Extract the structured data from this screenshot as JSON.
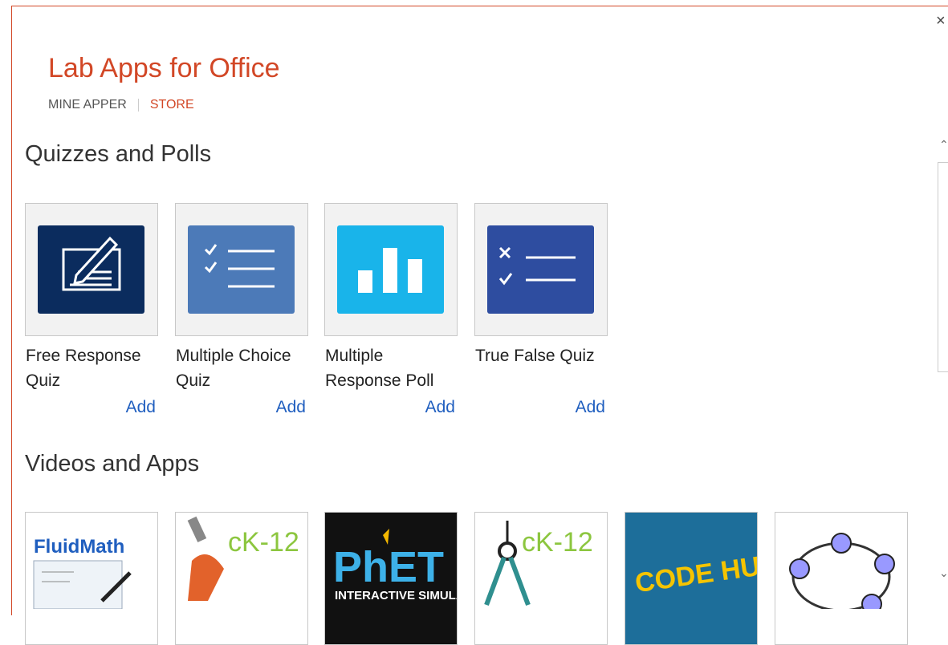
{
  "window": {
    "close_label": "×"
  },
  "header": {
    "title": "Lab Apps for Office",
    "tabs": [
      {
        "label": "MINE APPER"
      },
      {
        "label": "STORE"
      }
    ]
  },
  "sections": [
    {
      "title": "Quizzes and Polls",
      "items": [
        {
          "name": "Free Response Quiz",
          "add": "Add",
          "icon": "pencil-paper-icon",
          "color": "#0b2c5e"
        },
        {
          "name": "Multiple Choice Quiz",
          "add": "Add",
          "icon": "checklist-icon",
          "color": "#4c7ab8"
        },
        {
          "name": "Multiple Response Poll",
          "add": "Add",
          "icon": "bar-chart-icon",
          "color": "#19b4ea"
        },
        {
          "name": "True False Quiz",
          "add": "Add",
          "icon": "true-false-icon",
          "color": "#2e4da0"
        }
      ]
    },
    {
      "title": "Videos and Apps",
      "items": [
        {
          "logo_text": "FluidMath",
          "icon": "fluidmath-logo"
        },
        {
          "logo_text": "cK-12",
          "icon": "ck12-microscope-logo"
        },
        {
          "logo_text": "PhET",
          "logo_sub": "INTERACTIVE SIMULATIONS",
          "icon": "phet-logo"
        },
        {
          "logo_text": "cK-12",
          "icon": "ck12-compass-logo"
        },
        {
          "logo_text": "CODE HUNT",
          "icon": "codehunt-logo"
        },
        {
          "icon": "geogebra-logo"
        }
      ]
    }
  ]
}
